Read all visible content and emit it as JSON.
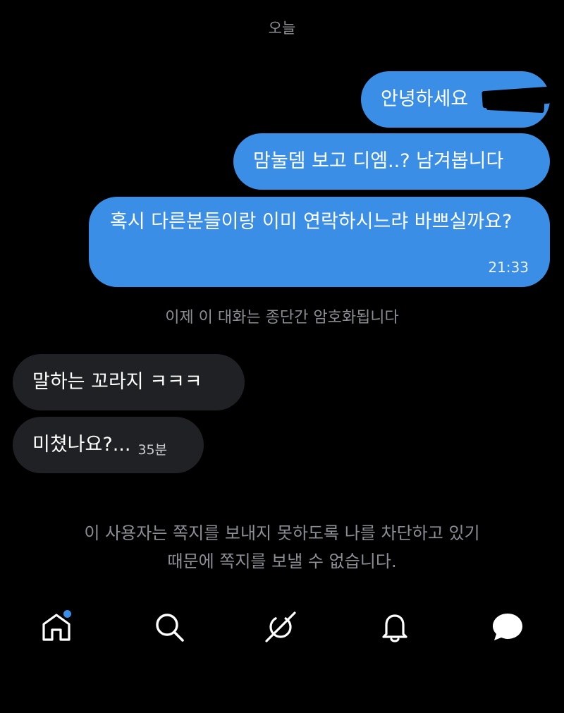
{
  "header": {
    "date_label": "오늘"
  },
  "messages": {
    "out_1": "안녕하세요 ",
    "out_2": "맘눌뎀 보고 디엠..? 남겨봅니다",
    "out_3": "혹시 다른분들이랑 이미 연락하시느랴 바쁘실까요?",
    "out_3_time": "21:33",
    "in_1": "말하는 꼬라지 ㅋㅋㅋ",
    "in_2": "미쳤나요?...",
    "in_2_time": "35분"
  },
  "system": {
    "encryption_note": "이제 이 대화는 종단간 암호화됩니다",
    "blocked_line_1": "이 사용자는 쪽지를 보내지 못하도록 나를 차단하고 있기",
    "blocked_line_2": "때문에 쪽지를 보낼 수 없습니다."
  },
  "nav": {
    "items": [
      {
        "icon": "home-icon",
        "has_badge": true
      },
      {
        "icon": "search-icon"
      },
      {
        "icon": "grok-icon"
      },
      {
        "icon": "bell-icon"
      },
      {
        "icon": "messages-icon"
      }
    ]
  },
  "colors": {
    "outgoing": "#3b8ee6",
    "incoming": "#1f2124",
    "background": "#000000",
    "muted_text": "#8b8f94"
  }
}
